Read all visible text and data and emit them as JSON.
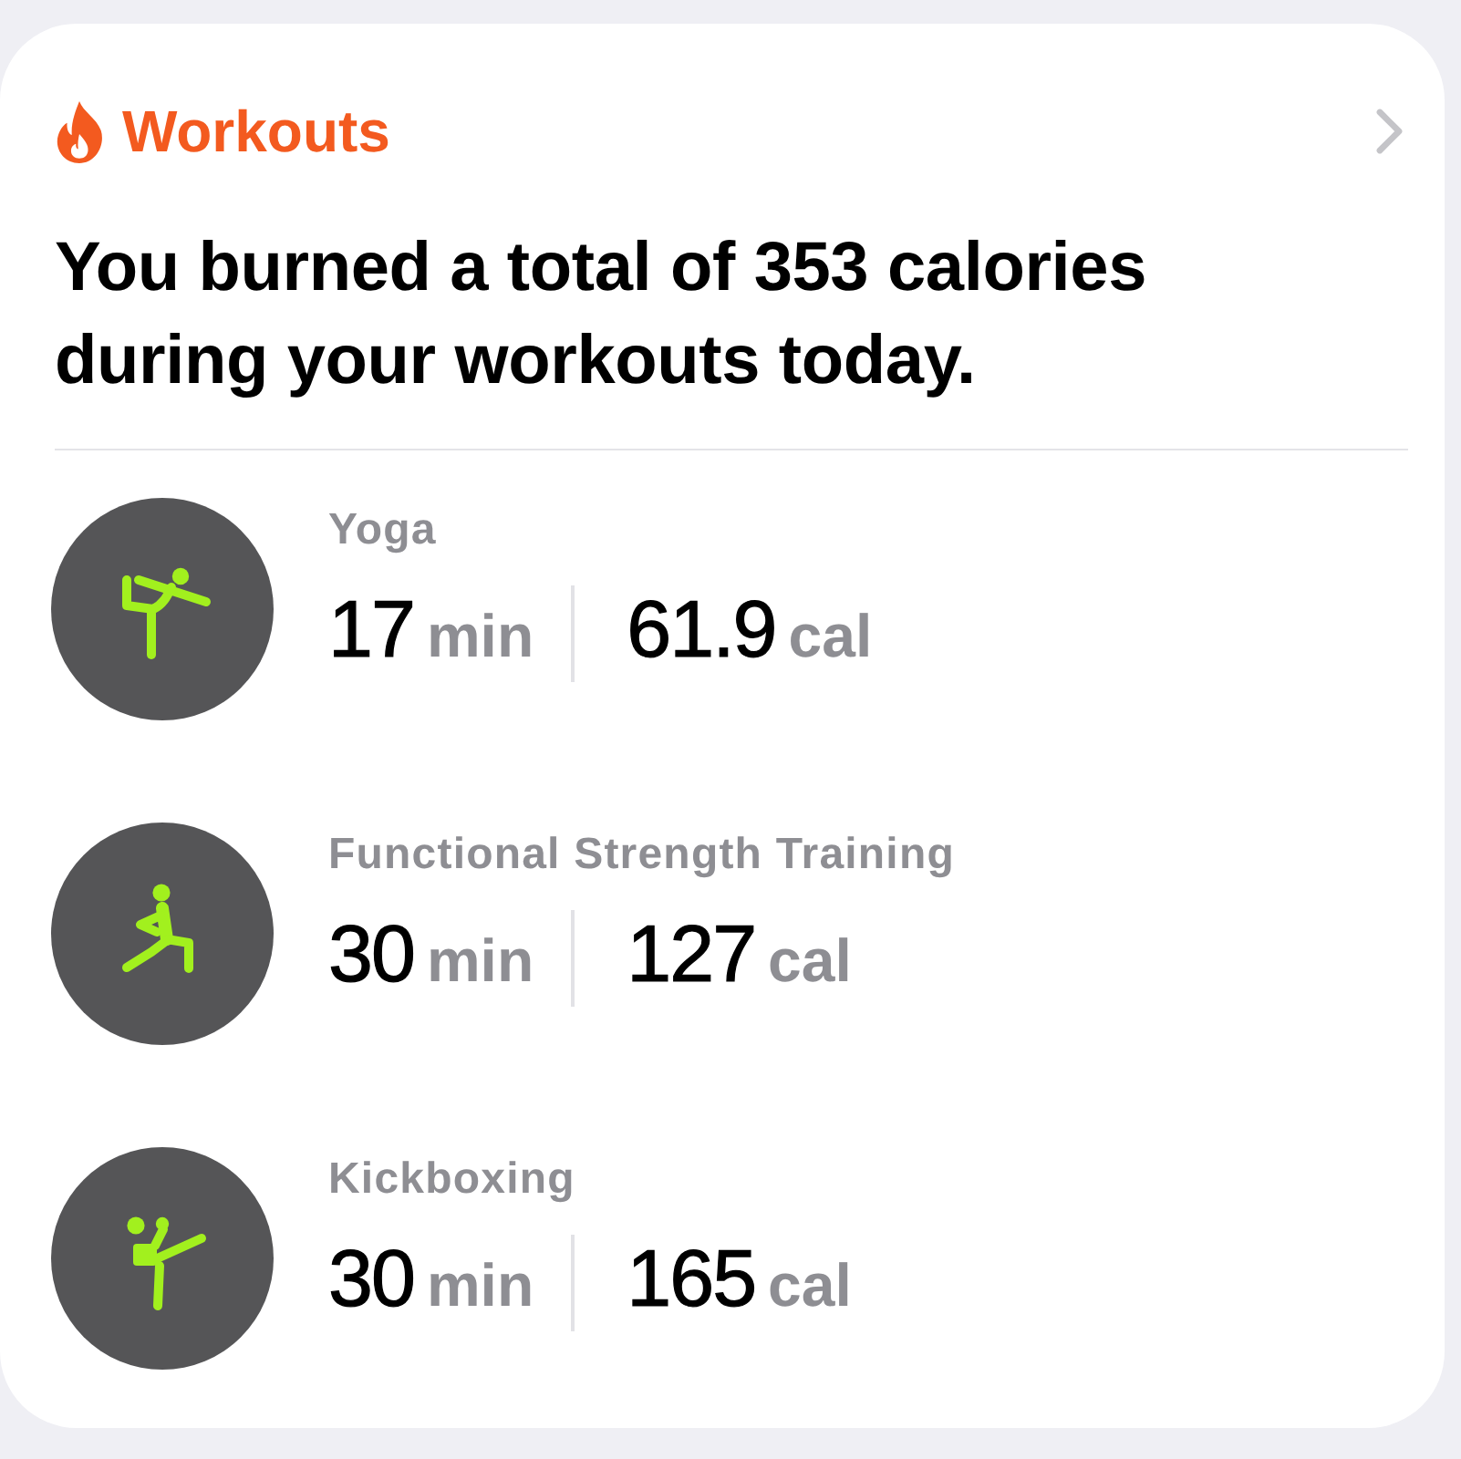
{
  "header": {
    "title": "Workouts"
  },
  "summary": "You burned a total of 353 calories during your workouts today.",
  "workouts": [
    {
      "kind": "yoga",
      "name": "Yoga",
      "duration": "17",
      "duration_unit": "min",
      "energy": "61.9",
      "energy_unit": "cal"
    },
    {
      "kind": "strength",
      "name": "Functional Strength Training",
      "duration": "30",
      "duration_unit": "min",
      "energy": "127",
      "energy_unit": "cal"
    },
    {
      "kind": "kickboxing",
      "name": "Kickboxing",
      "duration": "30",
      "duration_unit": "min",
      "energy": "165",
      "energy_unit": "cal"
    }
  ]
}
